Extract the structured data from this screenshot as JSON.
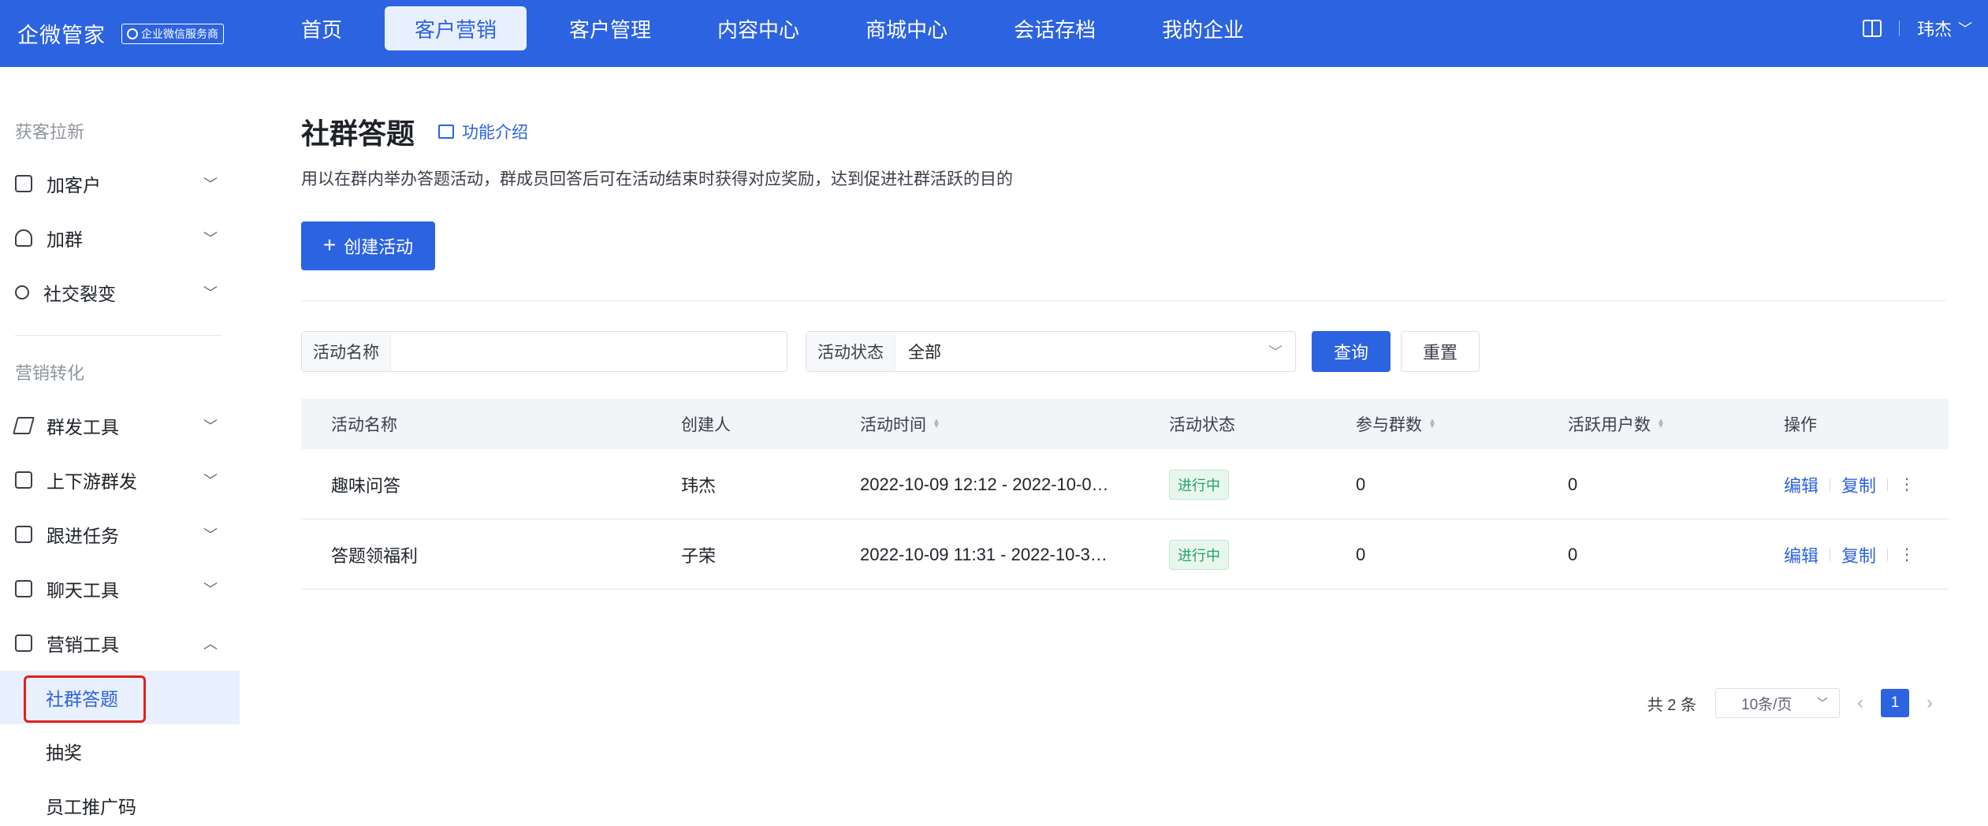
{
  "header": {
    "brand": "企微管家",
    "badge": "企业微信服务商",
    "nav": [
      "首页",
      "客户营销",
      "客户管理",
      "内容中心",
      "商城中心",
      "会话存档",
      "我的企业"
    ],
    "active_nav": "客户营销",
    "user": "玮杰"
  },
  "sidebar": {
    "section1": "获客拉新",
    "section2": "营销转化",
    "items": {
      "add_customer": "加客户",
      "add_group": "加群",
      "social_fission": "社交裂变",
      "group_send": "群发工具",
      "updown_send": "上下游群发",
      "follow_task": "跟进任务",
      "chat_tool": "聊天工具",
      "marketing_tool": "营销工具"
    },
    "subitems": {
      "quiz": "社群答题",
      "lottery": "抽奖",
      "staff_qr": "员工推广码"
    }
  },
  "page": {
    "title": "社群答题",
    "intro_link": "功能介绍",
    "description": "用以在群内举办答题活动，群成员回答后可在活动结束时获得对应奖励，达到促进社群活跃的目的",
    "create_button": "创建活动"
  },
  "filters": {
    "name_label": "活动名称",
    "name_value": "",
    "status_label": "活动状态",
    "status_value": "全部",
    "query": "查询",
    "reset": "重置"
  },
  "table": {
    "headers": {
      "name": "活动名称",
      "creator": "创建人",
      "time": "活动时间",
      "status": "活动状态",
      "groups": "参与群数",
      "active_users": "活跃用户数",
      "actions": "操作"
    },
    "rows": [
      {
        "name": "趣味问答",
        "creator": "玮杰",
        "time": "2022-10-09 12:12 - 2022-10-0…",
        "status": "进行中",
        "groups": "0",
        "active_users": "0",
        "edit": "编辑",
        "copy": "复制"
      },
      {
        "name": "答题领福利",
        "creator": "子荣",
        "time": "2022-10-09 11:31 - 2022-10-3…",
        "status": "进行中",
        "groups": "0",
        "active_users": "0",
        "edit": "编辑",
        "copy": "复制"
      }
    ]
  },
  "pagination": {
    "total": "共 2 条",
    "page_size": "10条/页",
    "current_page": "1"
  },
  "colors": {
    "primary": "#2c63e0",
    "success": "#21a366",
    "highlight_box": "#e0221c"
  }
}
